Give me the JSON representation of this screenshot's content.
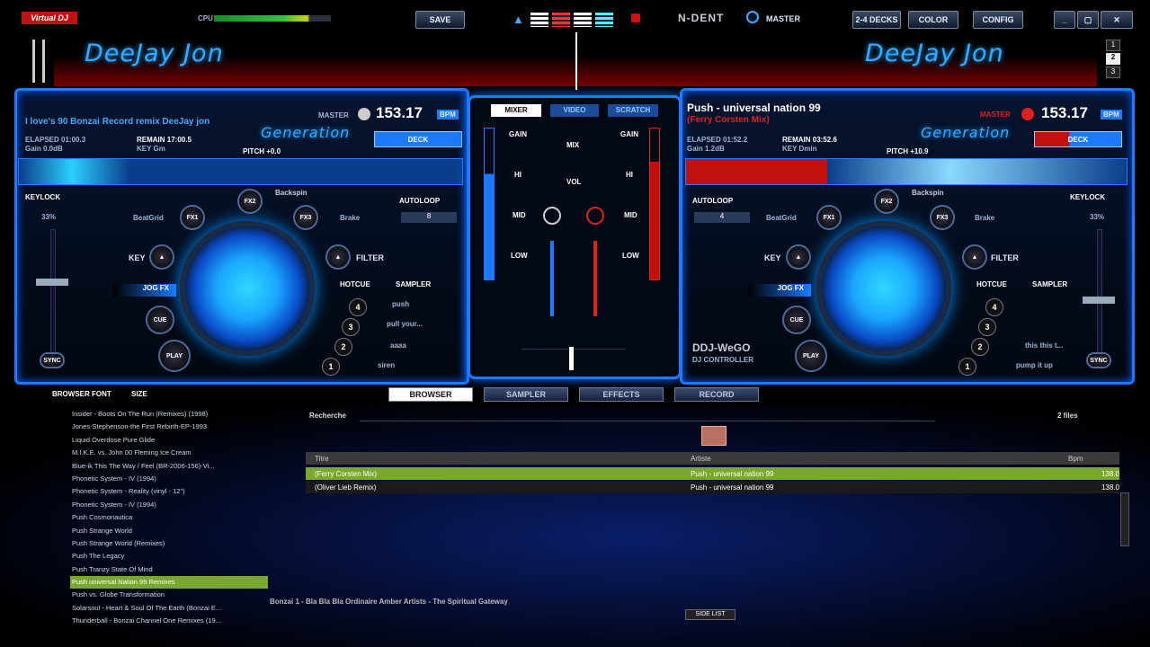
{
  "topbar": {
    "logo": "Virtual DJ",
    "cpu_label": "CPU",
    "save": "SAVE",
    "brand": "N-DENT",
    "master": "MASTER",
    "decks_btn": "2-4 DECKS",
    "color_btn": "COLOR",
    "config_btn": "CONFIG",
    "deck_numbers": [
      "1",
      "2",
      "3"
    ]
  },
  "left": {
    "name": "DeeJay Jon",
    "title": "I love's 90 Bonzai Record remix DeeJay jon",
    "generation": "Generation",
    "master": "MASTER",
    "bpm": "153.17",
    "bpm_unit": "BPM",
    "elapsed": "ELAPSED 01:00.3",
    "remain": "REMAIN 17:00.5",
    "gain": "Gain 0.0dB",
    "key": "KEY Gm",
    "pitch": "PITCH +0.0",
    "deck": "DECK",
    "keylock": "KEYLOCK",
    "pct": "33%",
    "backspin": "Backspin",
    "autoloop": "AUTOLOOP",
    "beatgrid": "BeatGrid",
    "brake": "Brake",
    "key_lbl": "KEY",
    "filter": "FILTER",
    "jogfx": "JOG FX",
    "hotcue": "HOTCUE",
    "sampler": "SAMPLER",
    "sync": "SYNC",
    "cue": "CUE",
    "play": "PLAY",
    "samples": [
      "push",
      "pull your...",
      "aaaa",
      "siren"
    ],
    "loop_val": "8"
  },
  "right": {
    "name": "DeeJay Jon",
    "title": "Push - universal nation 99",
    "subtitle": "(Ferry Corsten Mix)",
    "generation": "Generation",
    "master": "MASTER",
    "bpm": "153.17",
    "bpm_unit": "BPM",
    "elapsed": "ELAPSED 01:52.2",
    "remain": "REMAIN 03:52.6",
    "gain": "Gain 1.2dB",
    "key": "KEY Dmin",
    "pitch": "PITCH +10.9",
    "deck": "DECK",
    "keylock": "KEYLOCK",
    "pct": "33%",
    "backspin": "Backspin",
    "autoloop": "AUTOLOOP",
    "beatgrid": "BeatGrid",
    "brake": "Brake",
    "key_lbl": "KEY",
    "filter": "FILTER",
    "jogfx": "JOG FX",
    "hotcue": "HOTCUE",
    "sampler": "SAMPLER",
    "sync": "SYNC",
    "cue": "CUE",
    "play": "PLAY",
    "samples": [
      "this this t...",
      "pump it up"
    ],
    "loop_val": "4",
    "controller": "DDJ-WeGO",
    "controller_sub": "DJ CONTROLLER"
  },
  "mixer": {
    "tabs": [
      "MIXER",
      "VIDEO",
      "SCRATCH"
    ],
    "gain": "GAIN",
    "hi": "HI",
    "mid": "MID",
    "low": "LOW",
    "mix": "MIX",
    "vol": "VOL"
  },
  "tabs": {
    "browser_font": "BROWSER FONT",
    "size": "SIZE",
    "items": [
      "BROWSER",
      "SAMPLER",
      "EFFECTS",
      "RECORD"
    ]
  },
  "browser": {
    "search_label": "Recherche",
    "files_count": "2 files",
    "col_title": "Titre",
    "col_artist": "Artiste",
    "col_bpm": "Bpm",
    "side_list": "SIDE LIST",
    "tracks": [
      {
        "title": "(Ferry Corsten Mix)",
        "artist": "Push - universal nation 99",
        "bpm": "138.0"
      },
      {
        "title": "(Oliver Lieb Remix)",
        "artist": "Push - universal nation 99",
        "bpm": "138.0"
      }
    ],
    "folders": [
      "Insider - Boots On The Run (Remixes) (1998)",
      "Jones-Stephenson-the First Rebirth-EP-1993",
      "Liquid Overdose Pure Glide",
      "M.I.K.E. vs. John 00 Fleming Ice Cream",
      "Blue-ik This The Way / Feel (BR-2006-156)-Vi...",
      "Phonetic System - IV (1994)",
      "Phonetic System - Reality (vinyl - 12\")",
      "Phonetic System - IV (1994)",
      "Push Cosmonautica",
      "Push Strange World",
      "Push Strange World (Remixes)",
      "Push The Legacy",
      "Push Tranzy State Of Mind",
      "Push universal Nation 99 Remixes",
      "Push vs. Globe Transformation",
      "Solarsoul - Heart & Soul Of The Earth (Bonzai E...",
      "Thunderball - Bonzai Channel One Remixes (19..."
    ],
    "bottom_text": "Bonzai 1 - Bla Bla Bla Ordinaire Amber Artists - The Spiritual Gateway"
  },
  "colors": {
    "accent": "#1e7bff",
    "left": "#3aa8ff",
    "right": "#e02020",
    "selected": "#78a830"
  }
}
